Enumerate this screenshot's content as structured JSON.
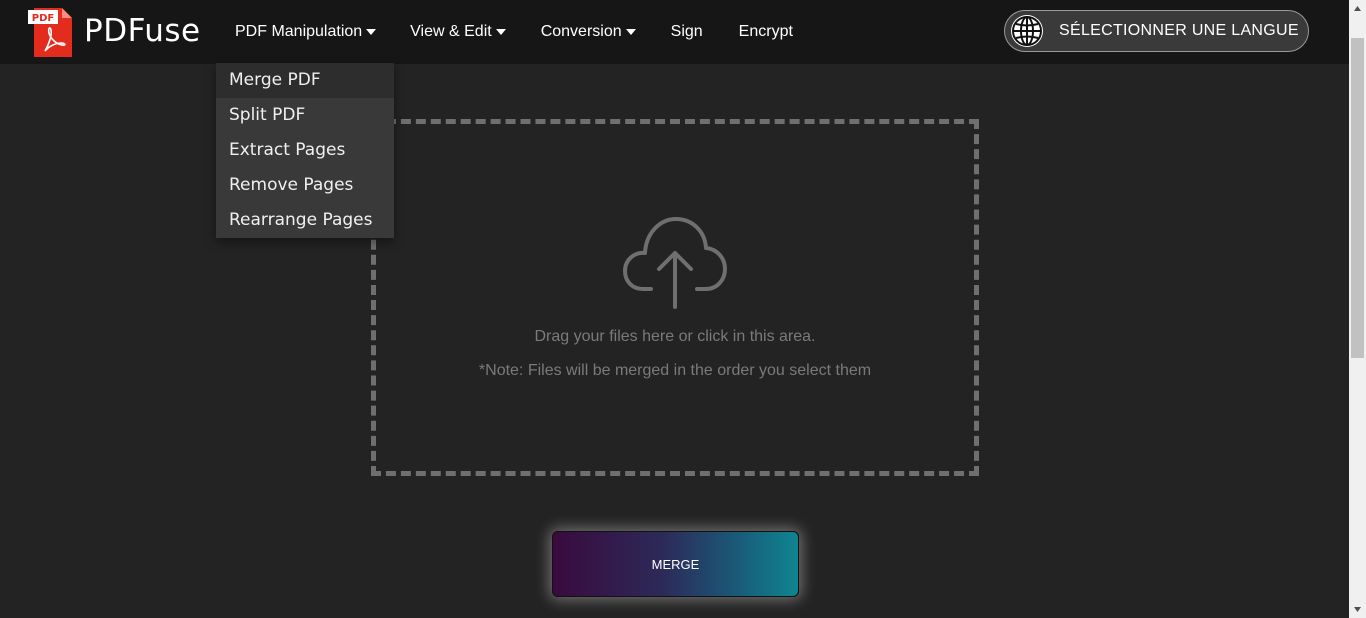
{
  "brand": {
    "name": "PDFuse",
    "icon_text": "PDF"
  },
  "nav": {
    "items": [
      {
        "label": "PDF Manipulation",
        "has_caret": true
      },
      {
        "label": "View & Edit",
        "has_caret": true
      },
      {
        "label": "Conversion",
        "has_caret": true
      },
      {
        "label": "Sign",
        "has_caret": false
      },
      {
        "label": "Encrypt",
        "has_caret": false
      }
    ],
    "language_button": "SÉLECTIONNER UNE LANGUE"
  },
  "dropdown": {
    "items": [
      "Merge PDF",
      "Split PDF",
      "Extract Pages",
      "Remove Pages",
      "Rearrange Pages"
    ]
  },
  "dropzone": {
    "text": "Drag your files here or click in this area.",
    "note": "*Note: Files will be merged in the order you select them"
  },
  "merge_button": "MERGE",
  "colors": {
    "background": "#232323",
    "navbar": "#161616",
    "pdf_red": "#e32b1e",
    "dropdown": "#393939"
  }
}
